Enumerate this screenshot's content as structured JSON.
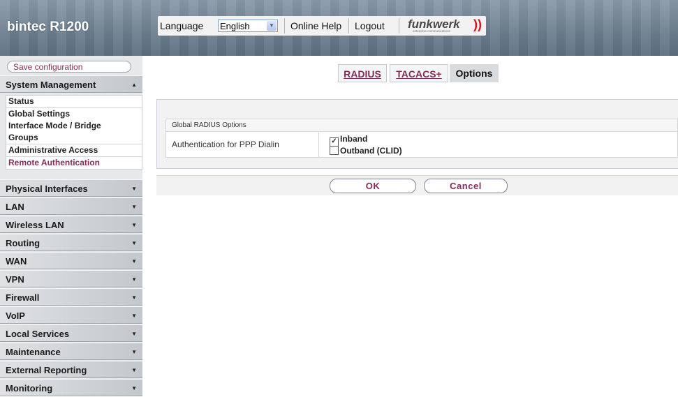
{
  "header": {
    "app_title": "bintec R1200",
    "language_label": "Language",
    "language_value": "English",
    "online_help": "Online Help",
    "logout": "Logout",
    "brand": "funkwerk",
    "brand_tagline": "enterprise communications",
    "brand_color": "#d2161c"
  },
  "sidebar": {
    "save_config": "Save configuration",
    "sections": [
      {
        "label": "System Management",
        "expanded": true
      },
      {
        "label": "Physical Interfaces"
      },
      {
        "label": "LAN"
      },
      {
        "label": "Wireless LAN"
      },
      {
        "label": "Routing"
      },
      {
        "label": "WAN"
      },
      {
        "label": "VPN"
      },
      {
        "label": "Firewall"
      },
      {
        "label": "VoIP"
      },
      {
        "label": "Local Services"
      },
      {
        "label": "Maintenance"
      },
      {
        "label": "External Reporting"
      },
      {
        "label": "Monitoring"
      }
    ],
    "sub_items": [
      {
        "label": "Status"
      },
      {
        "label": "Global Settings"
      },
      {
        "label": "Interface Mode / Bridge"
      },
      {
        "label": "Groups"
      },
      {
        "label": "Administrative Access"
      },
      {
        "label": "Remote Authentication",
        "active": true
      }
    ],
    "accent_color": "#832c5a"
  },
  "tabs": [
    {
      "label": "RADIUS"
    },
    {
      "label": "TACACS+"
    },
    {
      "label": "Options",
      "selected": true
    }
  ],
  "form": {
    "group_title": "Global RADIUS Options",
    "row_label": "Authentication for PPP Dialin",
    "options": [
      {
        "label": "Inband",
        "checked": true
      },
      {
        "label": "Outband (CLID)",
        "checked": false
      }
    ]
  },
  "buttons": {
    "ok": "OK",
    "cancel": "Cancel"
  }
}
